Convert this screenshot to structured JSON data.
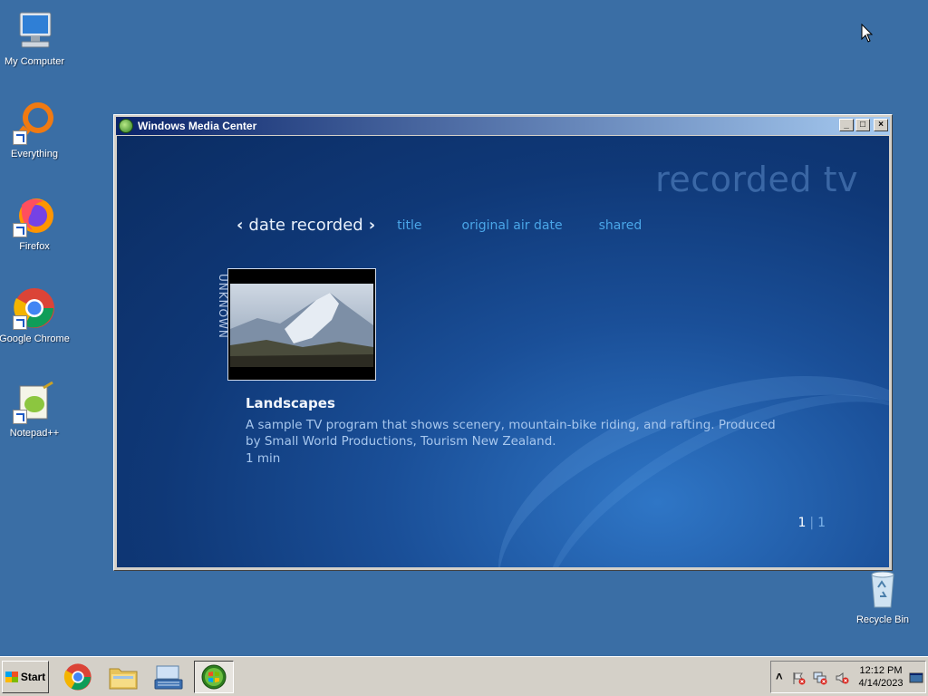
{
  "desktop": {
    "icons": [
      {
        "label": "My Computer"
      },
      {
        "label": "Everything"
      },
      {
        "label": "Firefox"
      },
      {
        "label": "Google Chrome"
      },
      {
        "label": "Notepad++"
      },
      {
        "label": "Recycle Bin"
      }
    ]
  },
  "window": {
    "title": "Windows Media Center",
    "minimize": "_",
    "maximize": "□",
    "close": "×"
  },
  "media_center": {
    "section_title": "recorded tv",
    "tabs": {
      "active": "date recorded",
      "prev_arrow": "‹",
      "next_arrow": "›",
      "others": [
        "title",
        "original air date",
        "shared"
      ]
    },
    "group_label": "UNKNOWN",
    "program": {
      "title": "Landscapes",
      "description": "A sample TV program that shows scenery, mountain-bike riding, and rafting. Produced by Small World Productions, Tourism New Zealand.",
      "duration": "1 min"
    },
    "pager": {
      "current": "1",
      "separator": "|",
      "total": "1"
    }
  },
  "taskbar": {
    "start_label": "Start",
    "tray_expand": "˄",
    "clock_time": "12:12 PM",
    "clock_date": "4/14/2023"
  },
  "colors": {
    "desktop": "#3a6ea5",
    "media_center_bg": "#0f3877",
    "tab_inactive": "#4aa6e8"
  }
}
